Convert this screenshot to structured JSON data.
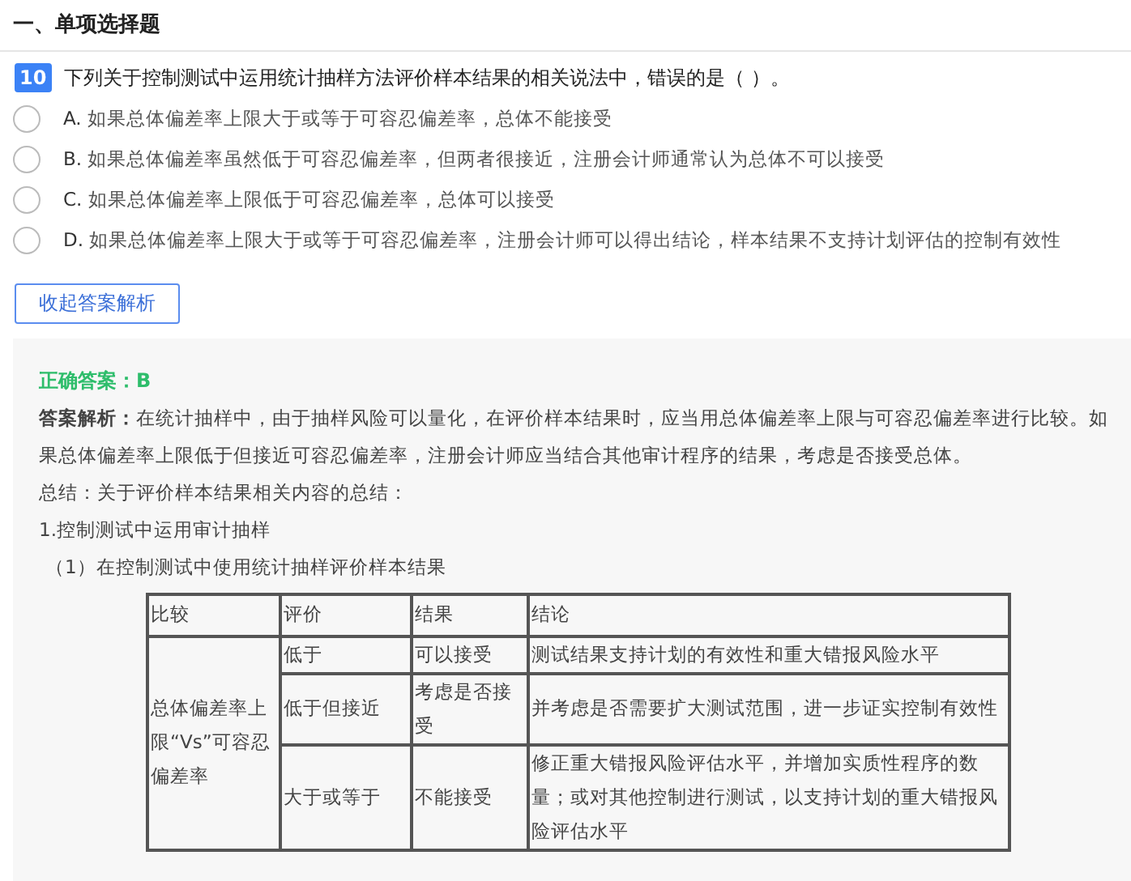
{
  "section_title": "一、单项选择题",
  "question": {
    "number": "10",
    "text": "下列关于控制测试中运用统计抽样方法评价样本结果的相关说法中，错误的是（   ）。"
  },
  "options": [
    {
      "label": "A.",
      "text": "如果总体偏差率上限大于或等于可容忍偏差率，总体不能接受",
      "selected": false
    },
    {
      "label": "B.",
      "text": "如果总体偏差率虽然低于可容忍偏差率，但两者很接近，注册会计师通常认为总体不可以接受",
      "selected": false
    },
    {
      "label": "C.",
      "text": "如果总体偏差率上限低于可容忍偏差率，总体可以接受",
      "selected": false
    },
    {
      "label": "D.",
      "text": "如果总体偏差率上限大于或等于可容忍偏差率，注册会计师可以得出结论，样本结果不支持计划评估的控制有效性",
      "selected": false
    }
  ],
  "toggle_button": "收起答案解析",
  "analysis": {
    "correct_answer": "正确答案：B",
    "paragraphs": [
      "**答案解析：**在统计抽样中，由于抽样风险可以量化，在评价样本结果时，应当用总体偏差率上限与可容忍偏差率进行比较。如果总体偏差率上限低于但接近可容忍偏差率，注册会计师应当结合其他审计程序的结果，考虑是否接受总体。",
      "总结：关于评价样本结果相关内容的总结：",
      "1.控制测试中运用审计抽样",
      "（1）在控制测试中使用统计抽样评价样本结果"
    ],
    "table": {
      "columns": [
        "比较",
        "评价",
        "结果",
        "结论"
      ],
      "group_label": "总体偏差率上限“Vs”可容忍偏差率",
      "rows": [
        {
          "evaluation": "低于",
          "result": "可以接受",
          "conclusion": "测试结果支持计划的有效性和重大错报风险水平"
        },
        {
          "evaluation": "低于但接近",
          "result": "考虑是否接受",
          "conclusion": "并考虑是否需要扩大测试范围，进一步证实控制有效性"
        },
        {
          "evaluation": "大于或等于",
          "result": "不能接受",
          "conclusion": "修正重大错报风险评估水平，并增加实质性程序的数量；或对其他控制进行测试，以支持计划的重大错报风险评估水平"
        }
      ]
    }
  }
}
